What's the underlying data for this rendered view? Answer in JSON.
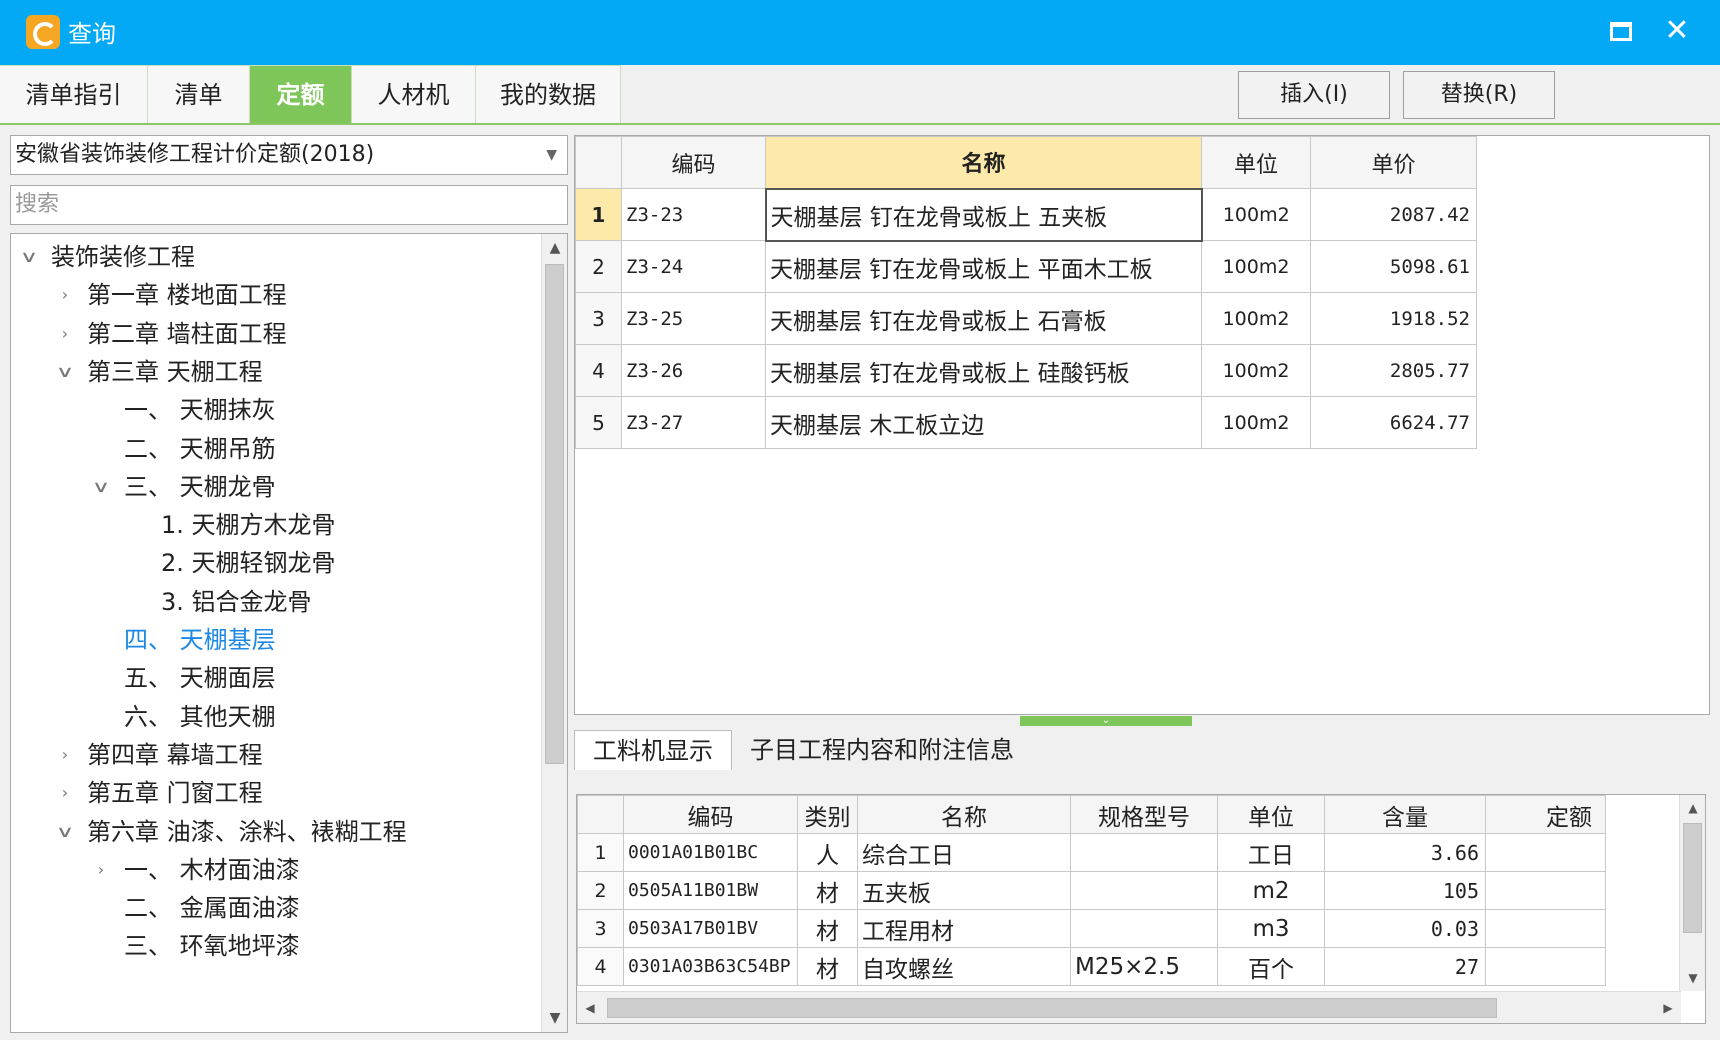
{
  "window": {
    "title": "查询",
    "maximize_icon": "maximize-icon",
    "close_icon": "close-icon",
    "close_glyph": "✕"
  },
  "tabs": [
    {
      "label": "清单指引",
      "active": false
    },
    {
      "label": "清单",
      "active": false
    },
    {
      "label": "定额",
      "active": true
    },
    {
      "label": "人材机",
      "active": false
    },
    {
      "label": "我的数据",
      "active": false
    }
  ],
  "toolbar": {
    "insert_label": "插入(I)",
    "replace_label": "替换(R)"
  },
  "left": {
    "library_select": "安徽省装饰装修工程计价定额(2018)",
    "search_placeholder": "搜索",
    "tree": [
      {
        "label": "装饰装修工程",
        "state": "expanded",
        "level": 0
      },
      {
        "label": "第一章  楼地面工程",
        "state": "collapsed",
        "level": 1
      },
      {
        "label": "第二章  墙柱面工程",
        "state": "collapsed",
        "level": 1
      },
      {
        "label": "第三章  天棚工程",
        "state": "expanded",
        "level": 1
      },
      {
        "label": "一、  天棚抹灰",
        "state": "leaf",
        "level": 2
      },
      {
        "label": "二、  天棚吊筋",
        "state": "leaf",
        "level": 2
      },
      {
        "label": "三、  天棚龙骨",
        "state": "expanded",
        "level": 2
      },
      {
        "label": "1.  天棚方木龙骨",
        "state": "leaf",
        "level": 3
      },
      {
        "label": "2.  天棚轻钢龙骨",
        "state": "leaf",
        "level": 3
      },
      {
        "label": "3.  铝合金龙骨",
        "state": "leaf",
        "level": 3
      },
      {
        "label": "四、  天棚基层",
        "state": "leaf",
        "level": 2,
        "selected": true
      },
      {
        "label": "五、  天棚面层",
        "state": "leaf",
        "level": 2
      },
      {
        "label": "六、  其他天棚",
        "state": "leaf",
        "level": 2
      },
      {
        "label": "第四章  幕墙工程",
        "state": "collapsed",
        "level": 1
      },
      {
        "label": "第五章  门窗工程",
        "state": "collapsed",
        "level": 1
      },
      {
        "label": "第六章  油漆、涂料、裱糊工程",
        "state": "expanded",
        "level": 1
      },
      {
        "label": "一、  木材面油漆",
        "state": "collapsed",
        "level": 2
      },
      {
        "label": "二、  金属面油漆",
        "state": "leaf",
        "level": 2
      },
      {
        "label": "三、  环氧地坪漆",
        "state": "leaf",
        "level": 2
      }
    ]
  },
  "quota_grid": {
    "headers": [
      "",
      "编码",
      "名称",
      "单位",
      "单价"
    ],
    "rows": [
      {
        "no": "1",
        "code": "Z3-23",
        "name": "天棚基层  钉在龙骨或板上  五夹板",
        "unit": "100m2",
        "price": "2087.42"
      },
      {
        "no": "2",
        "code": "Z3-24",
        "name": "天棚基层  钉在龙骨或板上  平面木工板",
        "unit": "100m2",
        "price": "5098.61"
      },
      {
        "no": "3",
        "code": "Z3-25",
        "name": "天棚基层  钉在龙骨或板上  石膏板",
        "unit": "100m2",
        "price": "1918.52"
      },
      {
        "no": "4",
        "code": "Z3-26",
        "name": "天棚基层  钉在龙骨或板上  硅酸钙板",
        "unit": "100m2",
        "price": "2805.77"
      },
      {
        "no": "5",
        "code": "Z3-27",
        "name": "天棚基层  木工板立边",
        "unit": "100m2",
        "price": "6624.77"
      }
    ]
  },
  "bottom_tabs": [
    {
      "label": "工料机显示",
      "active": true
    },
    {
      "label": "子目工程内容和附注信息",
      "active": false
    }
  ],
  "material_grid": {
    "headers": [
      "",
      "编码",
      "类别",
      "名称",
      "规格型号",
      "单位",
      "含量",
      "定额"
    ],
    "rows": [
      {
        "no": "1",
        "code": "0001A01B01BC",
        "type": "人",
        "name": "综合工日",
        "spec": "",
        "unit": "工日",
        "qty": "3.66"
      },
      {
        "no": "2",
        "code": "0505A11B01BW",
        "type": "材",
        "name": "五夹板",
        "spec": "",
        "unit": "m2",
        "qty": "105"
      },
      {
        "no": "3",
        "code": "0503A17B01BV",
        "type": "材",
        "name": "工程用材",
        "spec": "",
        "unit": "m3",
        "qty": "0.03"
      },
      {
        "no": "4",
        "code": "0301A03B63C54BP",
        "type": "材",
        "name": "自攻螺丝",
        "spec": "M25×2.5",
        "unit": "百个",
        "qty": "27"
      }
    ]
  }
}
